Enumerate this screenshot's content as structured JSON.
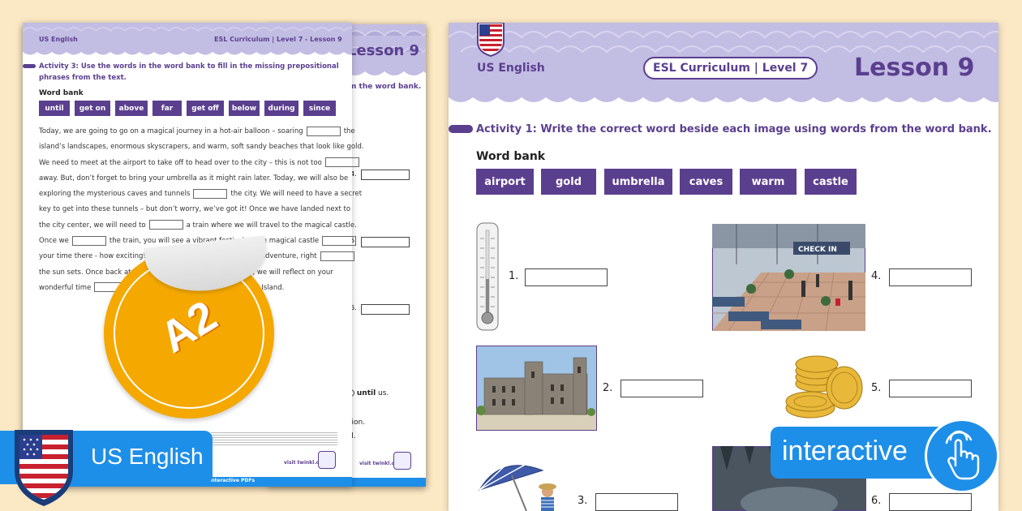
{
  "colors": {
    "accent": "#5b3f8f",
    "background": "#fbe8c4",
    "badge": "#f5a800",
    "badge_dark": "#e8e8e8",
    "interactive": "#1e8fe8",
    "scallop": "#c2bde3"
  },
  "back_sheet": {
    "header_left": "US English",
    "header_center": "ESL Curriculum | Level 7 - Lesson 9",
    "activity_title_line1": "Activity 3: Use the words in the word bank to fill in the missing prepositional",
    "activity_title_line2": "phrases from the text.",
    "word_bank_label": "Word bank",
    "words": [
      "until",
      "get on",
      "above",
      "far",
      "get off",
      "below",
      "during",
      "since"
    ],
    "paragraph": [
      "Today, we are going to go on a magical journey in a hot-air balloon – soaring",
      "island’s landscapes, enormous skyscrapers, and warm, soft sandy beaches that look like gold.",
      "We need to meet at the airport to take off to head over to the city – this is not too",
      "away. But, don’t forget to bring your umbrella as it might rain later. Today, we will also be",
      "exploring the mysterious caves and tunnels",
      "key to get into these tunnels – but don’t worry, we’ve got it! Once we have landed next to",
      "the city center, we will need to",
      "Once we",
      "your time there - how exciting! We have a day that is filled with adventure, right",
      "the sun sets. Once back at",
      "wonderful time"
    ],
    "para_tails": {
      "p5": "the city. We will need to have a secret",
      "p7": "a train where we will travel to the magical castle.",
      "p8": "the train, you will see a vibrant festival at the magical castle",
      "p10": ", we will reflect on your",
      "p11": "Island."
    },
    "footer_small": "visit twinkl.com",
    "footer_bar": "Interactive PDFs",
    "mid_lesson": "Lesson 9",
    "mid_instruction": "m the word bank.",
    "mid_nums": [
      "4.",
      "5.",
      "6."
    ],
    "mid_until_tail": "us.",
    "mid_until_bold": "until",
    "mid_tion": "tion.",
    "mid_d": "d."
  },
  "badge": {
    "level": "A2"
  },
  "main_sheet": {
    "header_left": "US English",
    "header_center": "ESL Curriculum | Level 7",
    "lesson": "Lesson 9",
    "activity_title": "Activity 1: Write the correct word beside each image using words from the word bank.",
    "word_bank_label": "Word bank",
    "words": [
      "airport",
      "gold",
      "umbrella",
      "caves",
      "warm",
      "castle"
    ],
    "numbers": [
      "1.",
      "2.",
      "3.",
      "4.",
      "5.",
      "6."
    ],
    "airport_sign": "CHECK IN"
  },
  "bottom_left_label": {
    "text": "US English"
  },
  "bottom_right_label": {
    "text": "interactive"
  }
}
